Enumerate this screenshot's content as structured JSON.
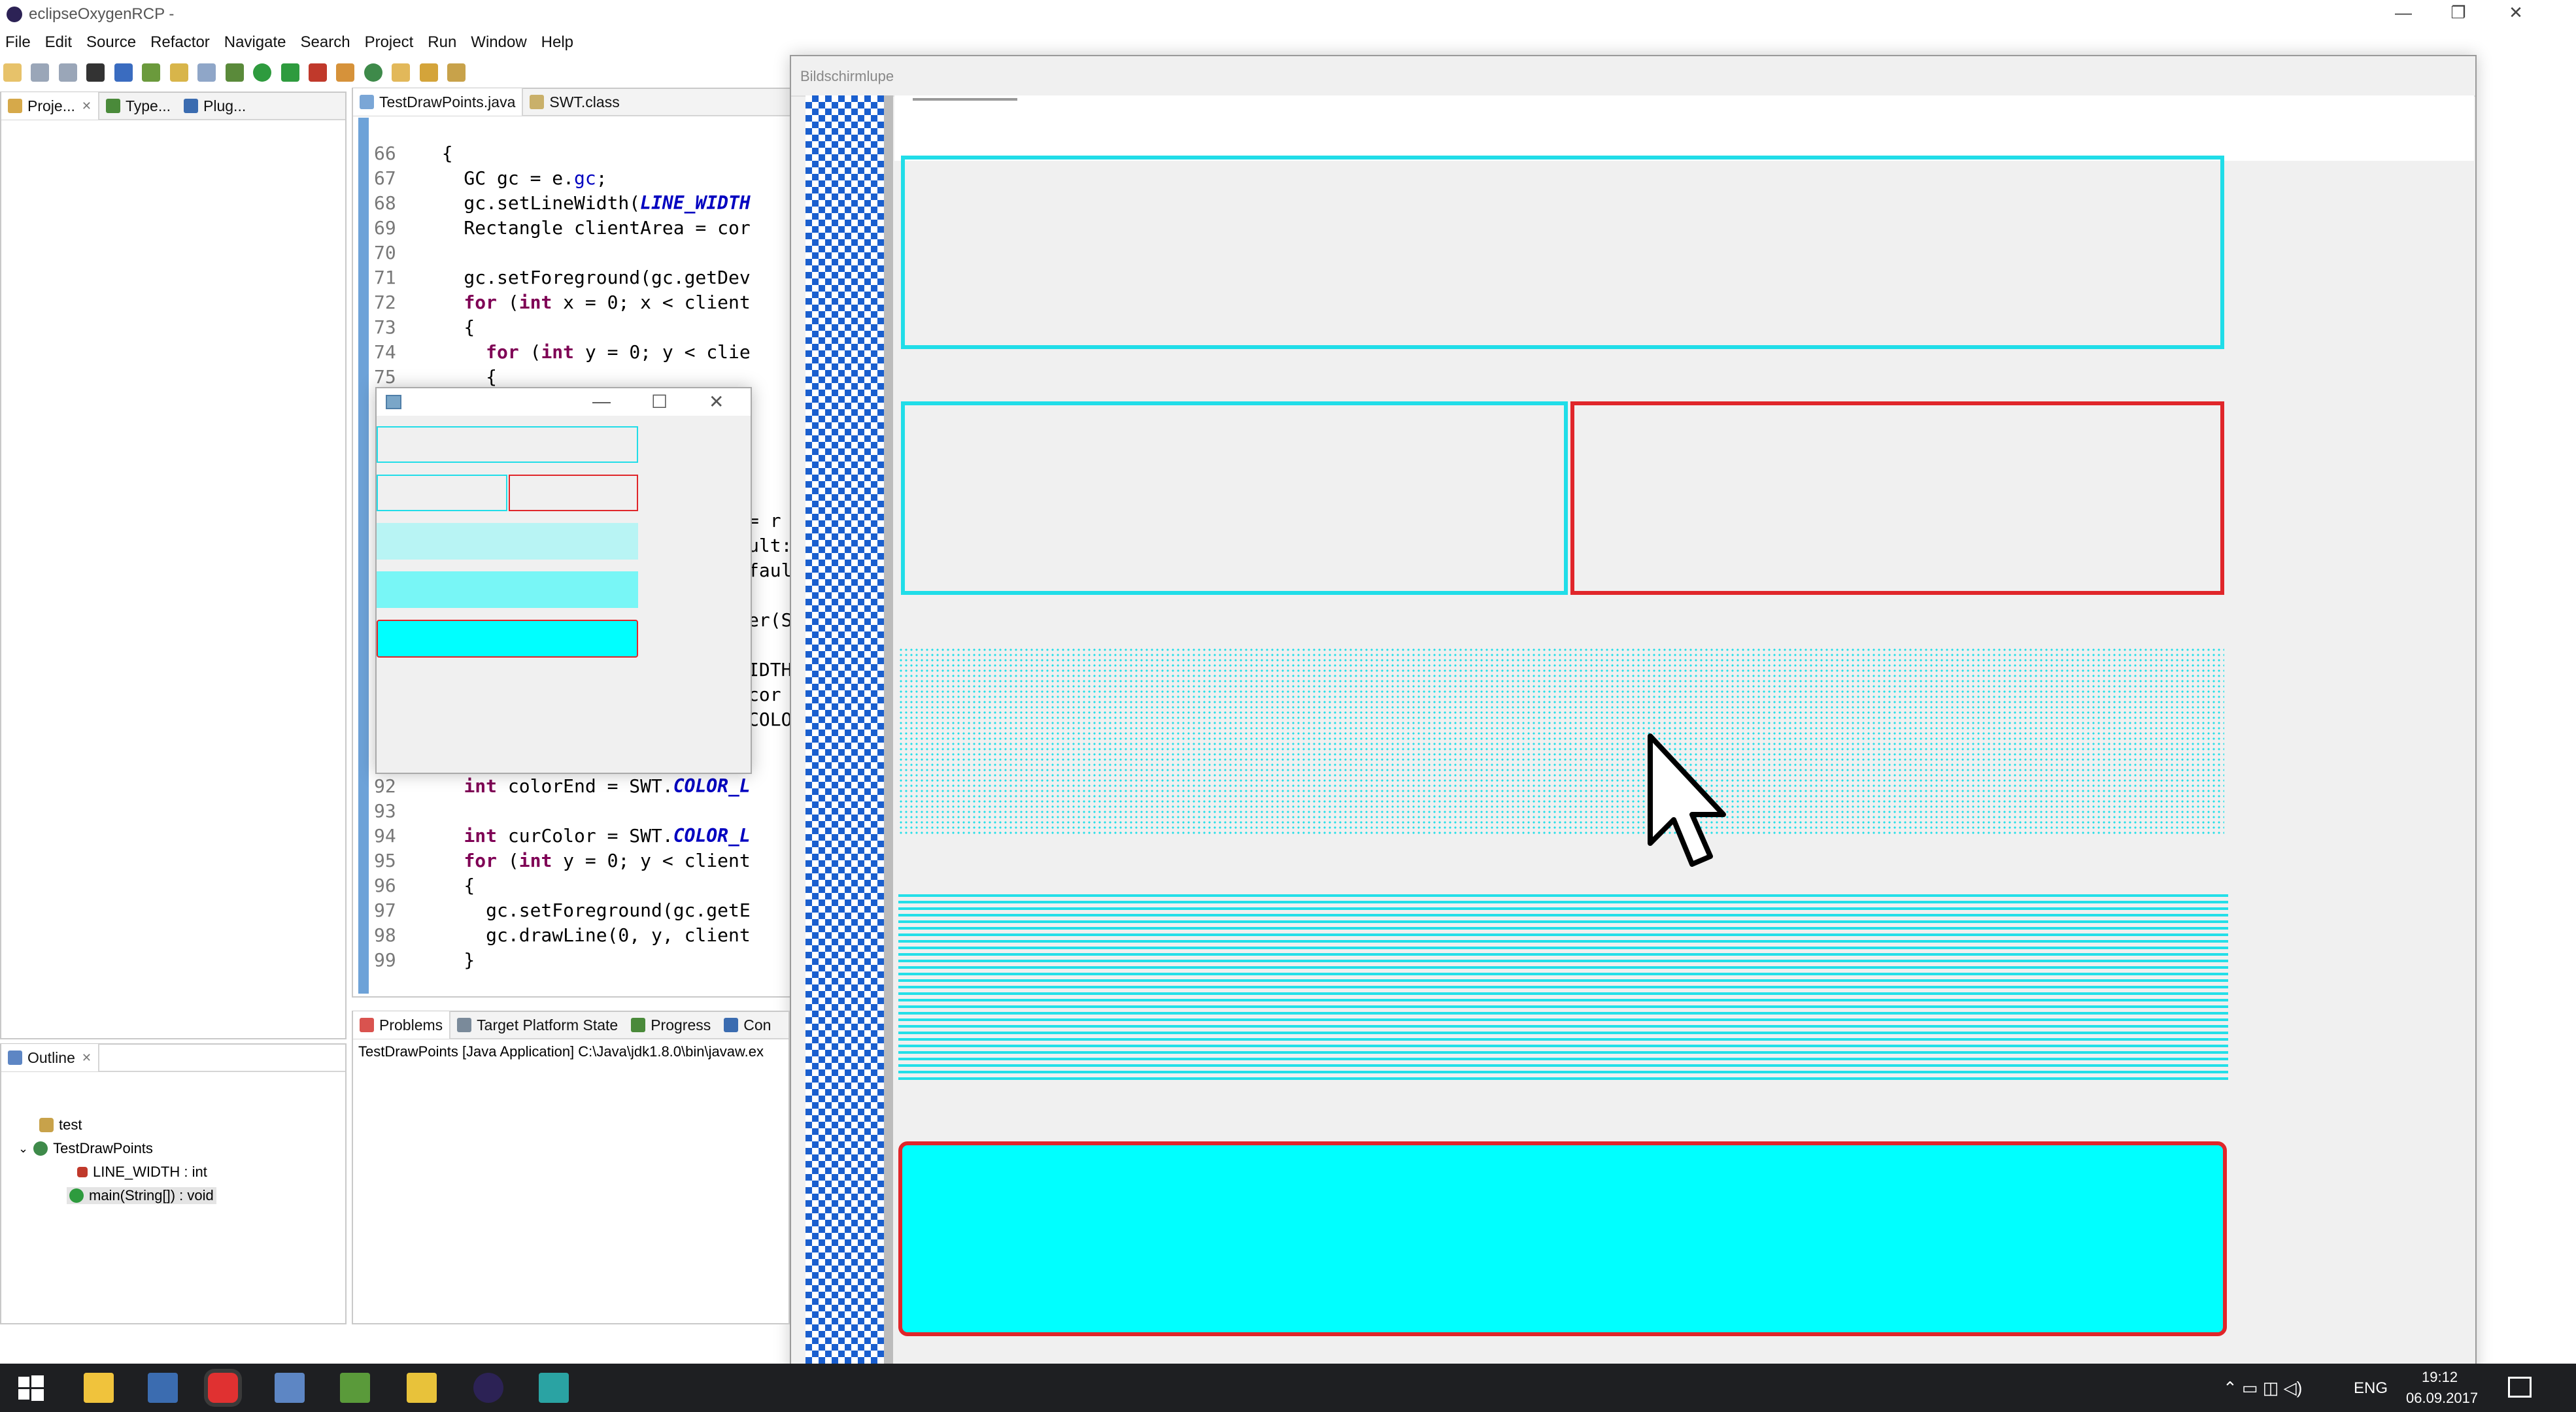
{
  "window": {
    "title": "eclipseOxygenRCP -"
  },
  "menu": [
    "File",
    "Edit",
    "Source",
    "Refactor",
    "Navigate",
    "Search",
    "Project",
    "Run",
    "Window",
    "Help"
  ],
  "left_tabs": [
    "Proje...",
    "Type...",
    "Plug..."
  ],
  "editor": {
    "tabs": [
      "TestDrawPoints.java",
      "SWT.class"
    ],
    "lines": [
      {
        "n": "66",
        "t": "  {"
      },
      {
        "n": "67",
        "t": "    GC gc = e.gc;"
      },
      {
        "n": "68",
        "t": "    gc.setLineWidth(LINE_WIDTH"
      },
      {
        "n": "69",
        "t": "    Rectangle clientArea = cor"
      },
      {
        "n": "70",
        "t": ""
      },
      {
        "n": "71",
        "t": "    gc.setForeground(gc.getDev"
      },
      {
        "n": "72",
        "t": "    for (int x = 0; x < client"
      },
      {
        "n": "73",
        "t": "    {"
      },
      {
        "n": "74",
        "t": "      for (int y = 0; y < clie"
      },
      {
        "n": "75",
        "t": "      {"
      },
      {
        "n": "92",
        "t": "    int colorEnd = SWT.COLOR_L"
      },
      {
        "n": "93",
        "t": ""
      },
      {
        "n": "94",
        "t": "    int curColor = SWT.COLOR_L"
      },
      {
        "n": "95",
        "t": "    for (int y = 0; y < client"
      },
      {
        "n": "96",
        "t": "    {"
      },
      {
        "n": "97",
        "t": "      gc.setForeground(gc.getE"
      },
      {
        "n": "98",
        "t": "      gc.drawLine(0, y, client"
      },
      {
        "n": "99",
        "t": "    }"
      }
    ],
    "partial_right": [
      "= r",
      "ult:",
      "faul",
      "er(S",
      "IDTH",
      "cor",
      "COLO"
    ]
  },
  "magnifier": {
    "title": "Bildschirmlupe"
  },
  "outline": {
    "tab": "Outline",
    "items": [
      "test",
      "TestDrawPoints",
      "LINE_WIDTH : int",
      "main(String[]) : void"
    ]
  },
  "console": {
    "tabs": [
      "Problems",
      "Target Platform State",
      "Progress",
      "Con"
    ],
    "text": "TestDrawPoints [Java Application] C:\\Java\\jdk1.8.0\\bin\\javaw.ex"
  },
  "taskbar": {
    "lang": "ENG",
    "time": "19:12",
    "date": "06.09.2017"
  },
  "colors": {
    "cyan": "#00ffff",
    "cyan_outline": "#20dde8",
    "red": "#e0262a",
    "light_cyan": "#b8f4f4",
    "mid_cyan": "#78f6f6"
  }
}
